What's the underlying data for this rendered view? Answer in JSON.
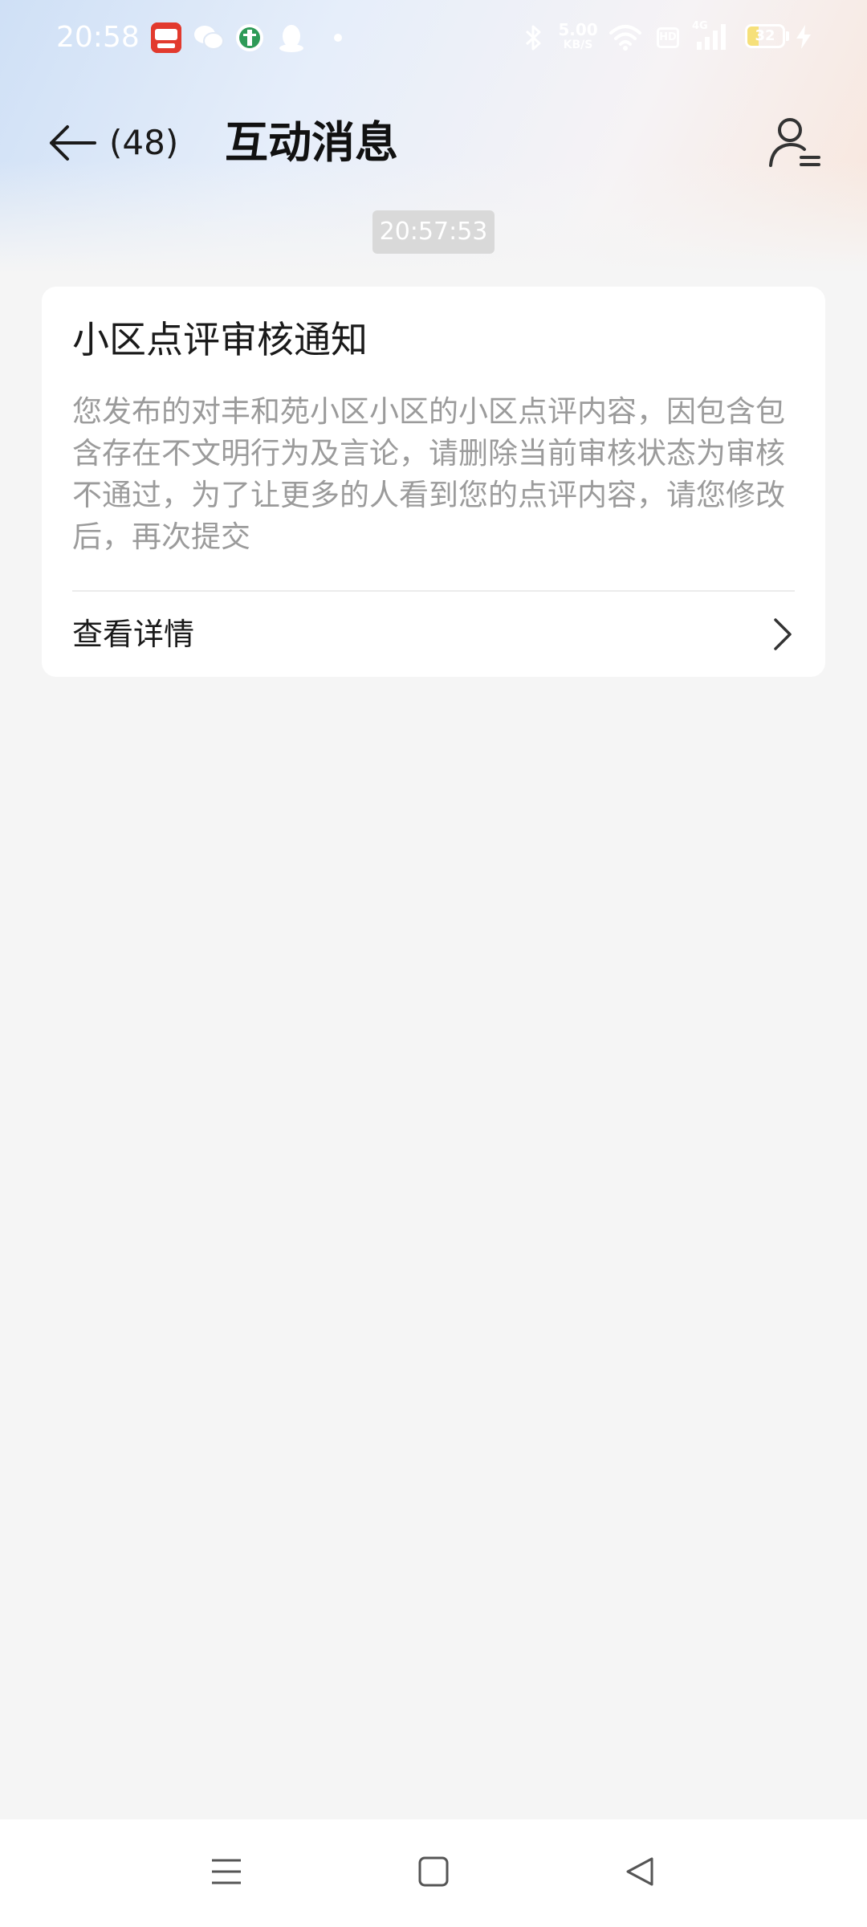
{
  "status_bar": {
    "time": "20:58",
    "net_speed_value": "5.00",
    "net_speed_unit": "KB/S",
    "hd_label": "HD",
    "network_type": "4G",
    "battery_percent": "32",
    "battery_level": 0.32,
    "app_icons": [
      "douyu-app-icon",
      "wechat-icon",
      "bank-app-icon",
      "qq-icon"
    ],
    "colors": {
      "battery_fill": "#f6e07a"
    }
  },
  "header": {
    "back_count": "(48)",
    "title": "互动消息"
  },
  "message": {
    "timestamp": "20:57:53",
    "card": {
      "title": "小区点评审核通知",
      "body": "您发布的对丰和苑小区小区的小区点评内容，因包含包含存在不文明行为及言论，请删除当前审核状态为审核不通过，为了让更多的人看到您的点评内容，请您修改后，再次提交",
      "link_label": "查看详情"
    }
  },
  "navigation": {
    "icons": [
      "menu-icon",
      "home-icon",
      "back-triangle-icon"
    ]
  }
}
